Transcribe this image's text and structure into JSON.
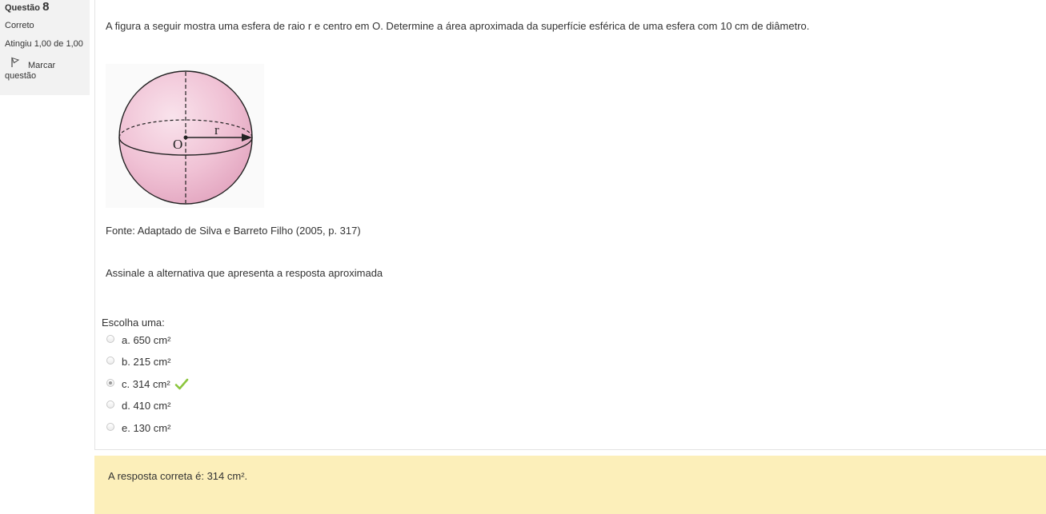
{
  "question_info": {
    "label": "Questão",
    "number": "8",
    "state": "Correto",
    "grade": "Atingiu 1,00 de 1,00",
    "flag_label_line1": "Marcar",
    "flag_label_line2": "questão"
  },
  "question": {
    "text": "A figura a seguir mostra uma esfera de raio r e centro em O. Determine a área aproximada da superfície esférica de uma esfera com 10 cm de diâmetro.",
    "figure": {
      "center_label": "O",
      "radius_label": "r"
    },
    "source": "Fonte: Adaptado de Silva e Barreto Filho (2005, p. 317)",
    "prompt": "Assinale a alternativa que apresenta a resposta aproximada"
  },
  "answer": {
    "choose_label": "Escolha uma:",
    "options": [
      {
        "label": "a. 650 cm²",
        "checked": false,
        "correct": false
      },
      {
        "label": "b. 215 cm²",
        "checked": false,
        "correct": false
      },
      {
        "label": "c. 314 cm²",
        "checked": true,
        "correct": true
      },
      {
        "label": "d. 410 cm²",
        "checked": false,
        "correct": false
      },
      {
        "label": "e. 130 cm²",
        "checked": false,
        "correct": false
      }
    ]
  },
  "feedback": {
    "text": "A resposta correta é: 314 cm²."
  },
  "colors": {
    "info_bg": "#f2f2f2",
    "feedback_bg": "#fcefba",
    "check_green": "#8cc63e",
    "sphere_fill": "#f2c6d8"
  }
}
